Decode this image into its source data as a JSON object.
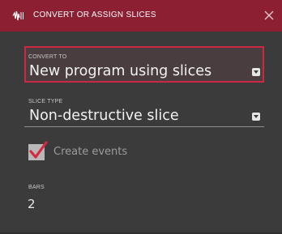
{
  "dialog": {
    "title": "CONVERT OR ASSIGN SLICES",
    "title_icon": "slice-waveform-icon",
    "close_icon": "close-icon"
  },
  "convert_to": {
    "label": "CONVERT TO",
    "value": "New program using slices"
  },
  "slice_type": {
    "label": "SLICE TYPE",
    "value": "Non-destructive slice"
  },
  "create_events": {
    "label": "Create events",
    "checked": true
  },
  "bars": {
    "label": "BARS",
    "value": "2"
  },
  "colors": {
    "titlebar": "#8d1f33",
    "accent": "#c92a42",
    "background": "#3b3b3c"
  }
}
